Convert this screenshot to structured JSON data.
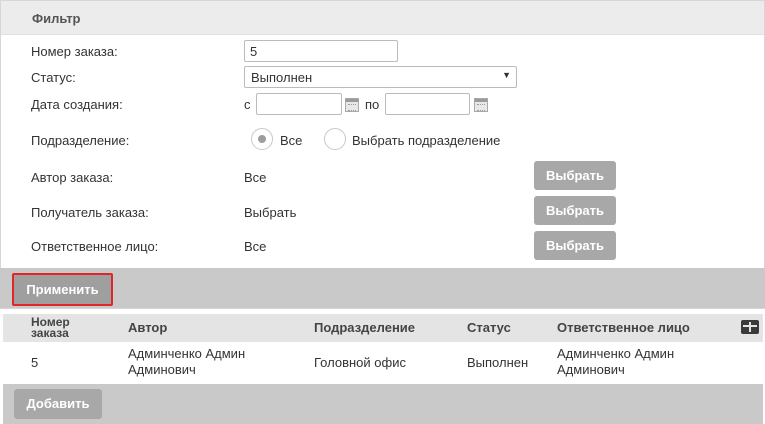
{
  "filter": {
    "title": "Фильтр",
    "order_number": {
      "label": "Номер заказа:",
      "value": "5"
    },
    "status": {
      "label": "Статус:",
      "value": "Выполнен"
    },
    "created": {
      "label": "Дата создания:",
      "from_label": "с",
      "to_label": "по",
      "from_value": "",
      "to_value": ""
    },
    "division": {
      "label": "Подразделение:",
      "option_all": "Все",
      "option_select": "Выбрать подразделение",
      "selected": "Все"
    },
    "author": {
      "label": "Автор заказа:",
      "value": "Все",
      "button": "Выбрать"
    },
    "recipient": {
      "label": "Получатель заказа:",
      "value": "Выбрать",
      "button": "Выбрать"
    },
    "responsible": {
      "label": "Ответственное лицо:",
      "value": "Все",
      "button": "Выбрать"
    },
    "apply_button": "Применить"
  },
  "table": {
    "columns": [
      "Номер заказа",
      "Автор",
      "Подразделение",
      "Статус",
      "Ответственное лицо"
    ],
    "col0_line1": "Номер",
    "col0_line2": "заказа",
    "rows": [
      {
        "number": "5",
        "author_line1": "Админченко Админ",
        "author_line2": "Админович",
        "division": "Головной офис",
        "status": "Выполнен",
        "responsible_line1": "Админченко Админ",
        "responsible_line2": "Админович"
      }
    ],
    "grid_icon": "table-settings-icon"
  },
  "add_button": "Добавить",
  "colors": {
    "highlight": "#e0262a",
    "button_gray": "#a8a8a8",
    "bar_gray": "#c9c9c9"
  }
}
